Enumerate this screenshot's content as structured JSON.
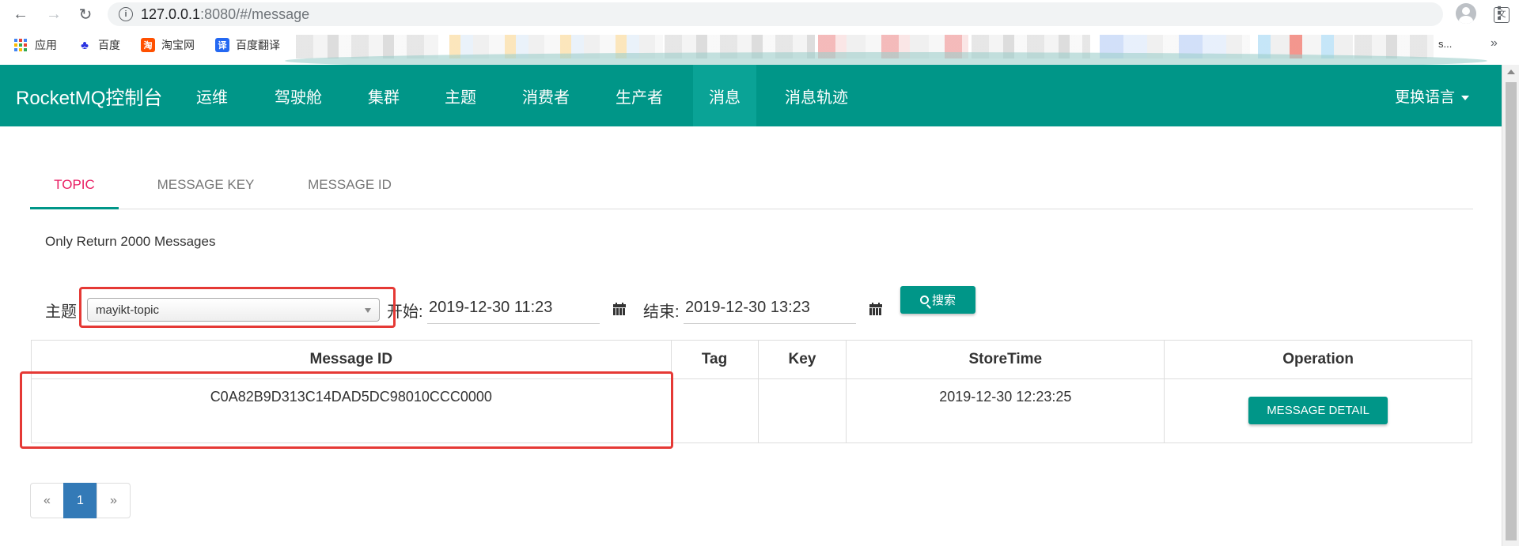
{
  "browser": {
    "url_host": "127.0.0.1",
    "url_rest": ":8080/#/message",
    "bookmarks": [
      {
        "label": "应用",
        "icon": "apps-grid-icon"
      },
      {
        "label": "百度",
        "icon": "baidu-paw-icon"
      },
      {
        "label": "淘宝网",
        "icon": "taobao-icon"
      },
      {
        "label": "百度翻译",
        "icon": "baidu-translate-icon"
      }
    ],
    "bookmarks_more": "s...",
    "colors": {
      "chrome_bg": "#f1f3f4",
      "taobao": "#ff5000",
      "translate": "#2468f2",
      "baidu": "#2932e1"
    }
  },
  "navbar": {
    "brand": "RocketMQ控制台",
    "items": [
      "运维",
      "驾驶舱",
      "集群",
      "主题",
      "消费者",
      "生产者",
      "消息",
      "消息轨迹"
    ],
    "active_index": 6,
    "language": "更换语言",
    "color": "#009688"
  },
  "tabs": {
    "items": [
      "TOPIC",
      "MESSAGE KEY",
      "MESSAGE ID"
    ],
    "active_index": 0
  },
  "info_text": "Only Return 2000 Messages",
  "search": {
    "topic_label": "主题",
    "topic_value": "mayikt-topic",
    "start_label": "开始:",
    "start_value": "2019-12-30 11:23",
    "end_label": "结束:",
    "end_value": "2019-12-30 13:23",
    "button_label": "搜索"
  },
  "table": {
    "headers": [
      "Message ID",
      "Tag",
      "Key",
      "StoreTime",
      "Operation"
    ],
    "rows": [
      {
        "message_id": "C0A82B9D313C14DAD5DC98010CCC0000",
        "tag": "",
        "key": "",
        "store_time": "2019-12-30 12:23:25",
        "operation": "MESSAGE DETAIL"
      }
    ]
  },
  "pagination": {
    "prev": "«",
    "pages": [
      "1"
    ],
    "next": "»",
    "current": "1"
  }
}
